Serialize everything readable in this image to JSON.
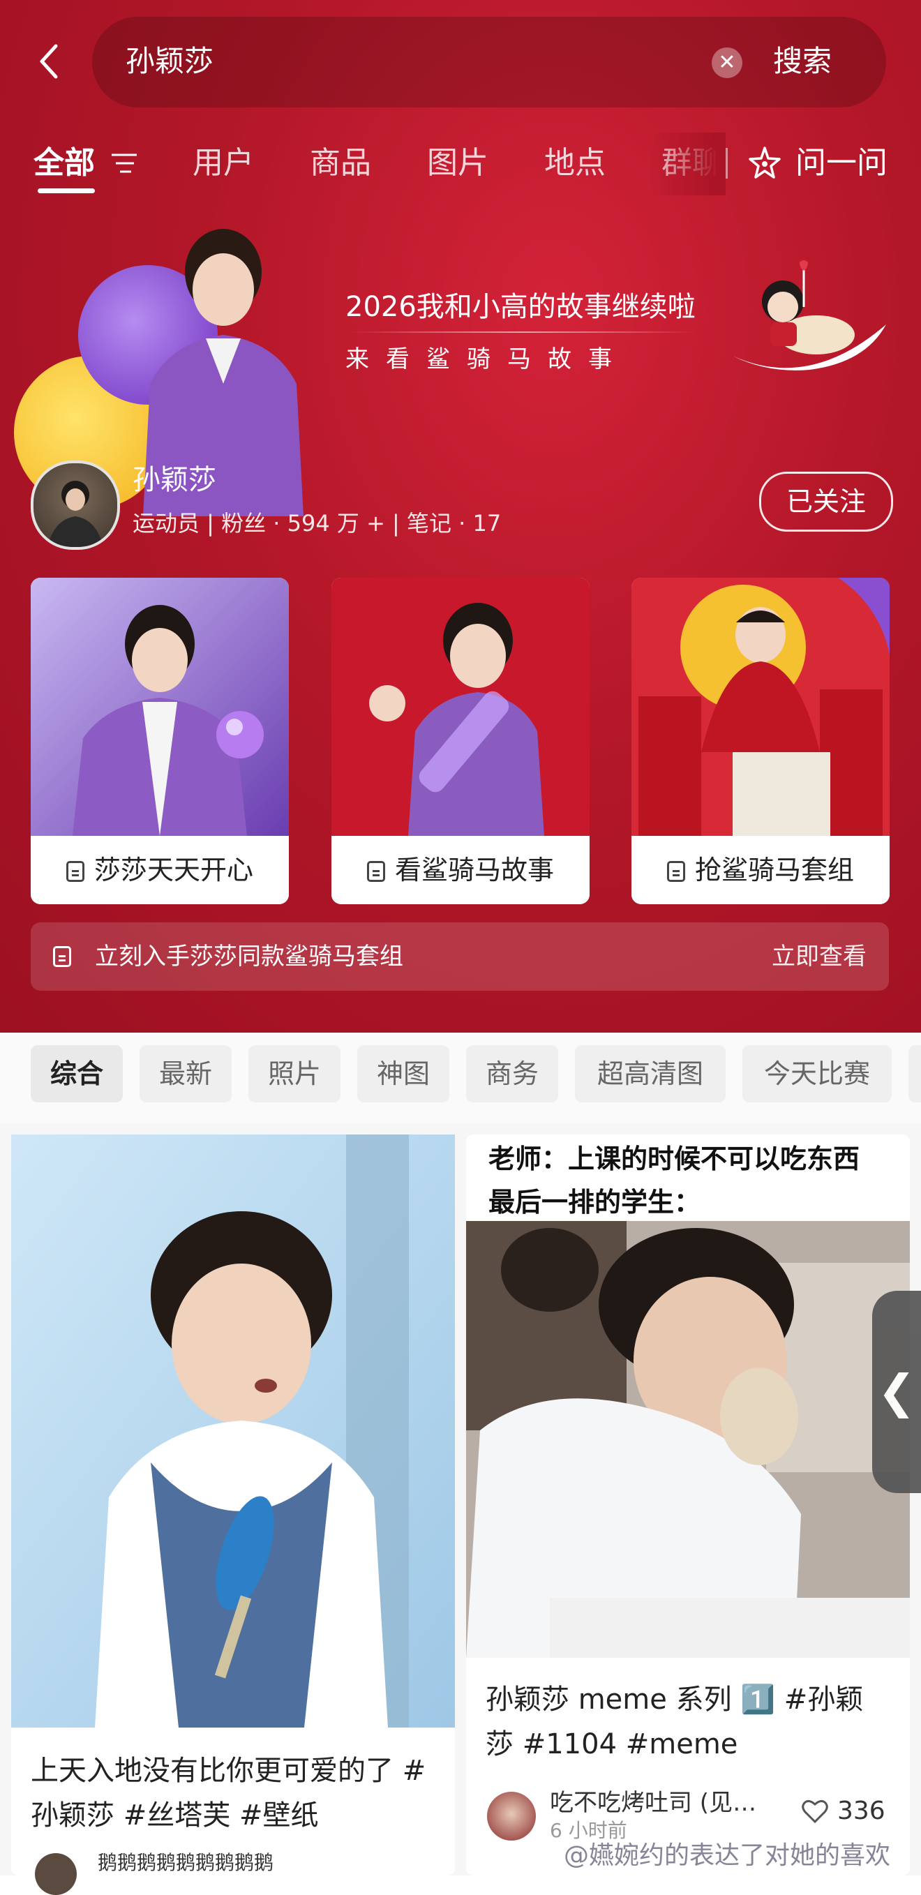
{
  "search": {
    "query": "孙颖莎",
    "clear_icon": "clear-icon",
    "button": "搜索",
    "back_icon": "back-chevron-icon"
  },
  "tabs": [
    "全部",
    "用户",
    "商品",
    "图片",
    "地点",
    "群聊"
  ],
  "ask": {
    "label": "问一问",
    "icon": "sparkle-icon"
  },
  "banner": {
    "line1": "2026我和小高的故事继续啦",
    "line2": "来看鲨骑马故事"
  },
  "profile": {
    "name": "孙颖莎",
    "meta": "运动员 | 粉丝 · 594 万 + | 笔记 · 17",
    "follow": "已关注"
  },
  "cards": [
    {
      "label": "莎莎天天开心"
    },
    {
      "label": "看鲨骑马故事"
    },
    {
      "label": "抢鲨骑马套组"
    }
  ],
  "promo": {
    "text": "立刻入手莎莎同款鲨骑马套组",
    "link": "立即查看"
  },
  "chips": [
    "综合",
    "最新",
    "照片",
    "神图",
    "商务",
    "超高清图",
    "今天比赛"
  ],
  "notes": [
    {
      "title": "上天入地没有比你更可爱的了 #孙颖莎  #丝塔芙 #壁纸",
      "author": "鹅鹅鹅鹅鹅鹅鹅鹅鹅",
      "likes": ""
    },
    {
      "caption1": "老师：上课的时候不可以吃东西",
      "caption2": "最后一排的学生：",
      "title": "孙颖莎 meme 系列 1️⃣ #孙颖莎 #1104  #meme",
      "author": "吃不吃烤吐司 (见…",
      "time": "6 小时前",
      "likes": "336"
    }
  ],
  "watermark": "@嬿婉约的表达了对她的喜欢",
  "colors": {
    "brand_red": "#b21728",
    "chip_bg": "#efefef"
  }
}
